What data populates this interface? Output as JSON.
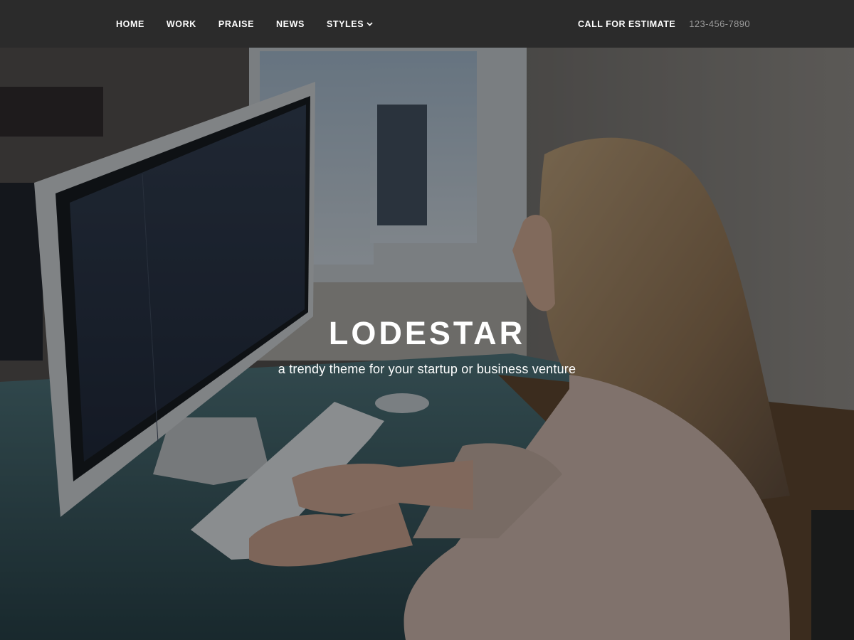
{
  "nav": {
    "items": [
      {
        "label": "HOME"
      },
      {
        "label": "WORK"
      },
      {
        "label": "PRAISE"
      },
      {
        "label": "NEWS"
      },
      {
        "label": "STYLES",
        "has_dropdown": true,
        "icon": "chevron-down-icon"
      }
    ],
    "cta_label": "CALL FOR ESTIMATE",
    "phone": "123-456-7890"
  },
  "hero": {
    "title": "LODESTAR",
    "subtitle": "a trendy theme for your startup or business venture",
    "background_image": "woman-typing-at-desktop-computer-photo"
  },
  "colors": {
    "navbar_bg": "#2b2b2b",
    "nav_text": "#ffffff",
    "phone_text": "#9b9b9b",
    "hero_text": "#ffffff"
  }
}
